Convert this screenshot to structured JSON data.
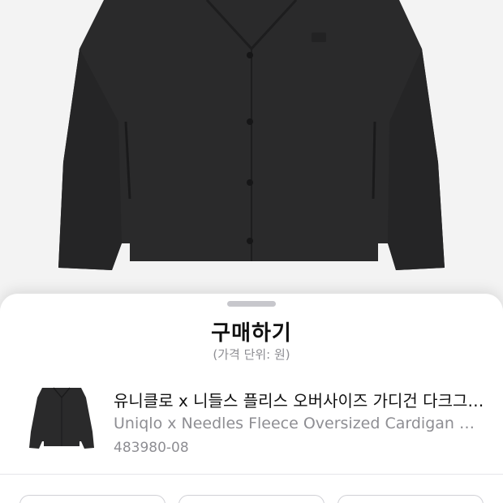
{
  "hero": {
    "image": "black-fleece-cardigan-photo",
    "background": "#f3f3f3",
    "garment_color": "#2a2a2b"
  },
  "sheet": {
    "title": "구매하기",
    "subtitle": "(가격 단위: 원)"
  },
  "product": {
    "thumbnail": "black-fleece-cardigan-thumbnail",
    "name": "유니클로 x 니들스 플리스 오버사이즈 가디건 다크그레이",
    "subtitle": "Uniqlo x Needles Fleece Oversized Cardigan Dark Gray",
    "code": "483980-08"
  },
  "options": {
    "count_visible": 3
  }
}
